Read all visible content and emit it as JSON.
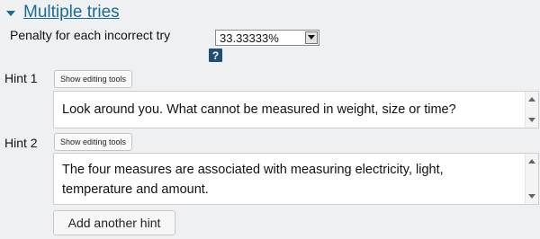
{
  "section": {
    "title": "Multiple tries",
    "toggle_icon": "triangle-down-icon"
  },
  "penalty": {
    "label": "Penalty for each incorrect try",
    "value": "33.33333%",
    "help_icon_text": "?"
  },
  "hints": [
    {
      "label": "Hint 1",
      "tools_label": "Show editing tools",
      "text": "Look around you. What cannot be measured in weight, size or time?"
    },
    {
      "label": "Hint 2",
      "tools_label": "Show editing tools",
      "text_line1": "The four measures are associated with measuring electricity, light,",
      "text_line2": "temperature and amount."
    }
  ],
  "add_hint_label": "Add another hint",
  "colors": {
    "link": "#1a6c95",
    "help_icon_bg": "#1f4f73",
    "background": "#eef0f2"
  }
}
